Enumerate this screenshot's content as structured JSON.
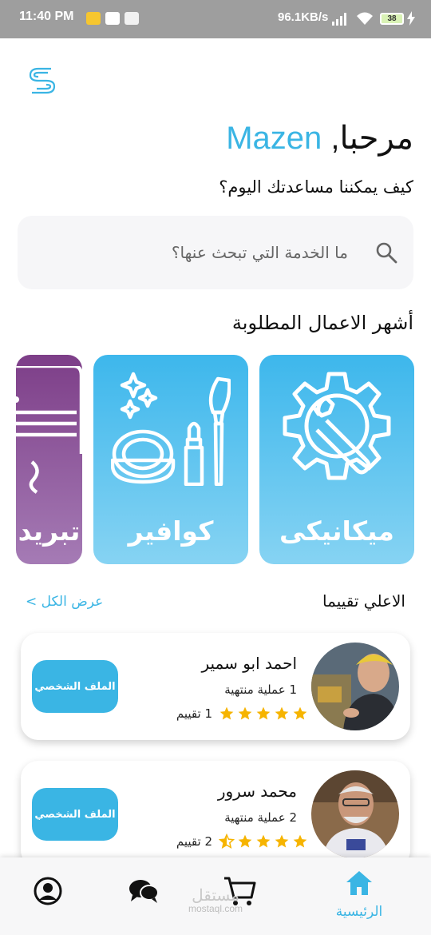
{
  "status_bar": {
    "time": "11:40 PM",
    "network_speed": "96.1KB/s",
    "battery": "38"
  },
  "header": {
    "logo_icon": "s-logo-icon"
  },
  "greeting": {
    "hello": "مرحبا,",
    "name": "Mazen",
    "subtitle": "كيف يمكننا مساعدتك اليوم؟"
  },
  "search": {
    "placeholder": "ما الخدمة التي تبحث عنها؟",
    "icon": "search-icon"
  },
  "popular": {
    "title": "أشهر الاعمال المطلوبة",
    "categories": [
      {
        "label": "ميكانيكى",
        "icon": "gear-wrench-icon",
        "color": "#3db7ec"
      },
      {
        "label": "كوافير",
        "icon": "makeup-brush-icon",
        "color": "#3db7ec"
      },
      {
        "label": "تبريد",
        "icon": "air-conditioner-icon",
        "color": "#7d3e88"
      }
    ]
  },
  "top_rated": {
    "title": "الاعلي تقييما",
    "view_all": "عرض الكل >",
    "professionals": [
      {
        "name": "احمد ابو سمير",
        "jobs": "1 عملية منتهية",
        "rating_text": "1 تقييم",
        "stars": 5,
        "profile_button": "الملف الشخصي"
      },
      {
        "name": "محمد سرور",
        "jobs": "2 عملية منتهية",
        "rating_text": "2 تقييم",
        "stars": 4.5,
        "profile_button": "الملف الشخصي"
      }
    ]
  },
  "bottom_nav": {
    "home_label": "الرئيسية",
    "items": [
      "profile-icon",
      "chat-icon",
      "cart-icon",
      "home-icon"
    ]
  },
  "watermark": {
    "arabic": "مستقل",
    "latin": "mostaql.com"
  },
  "colors": {
    "accent": "#3ab5e4",
    "star": "#f6b400",
    "purple": "#7d3e88"
  }
}
